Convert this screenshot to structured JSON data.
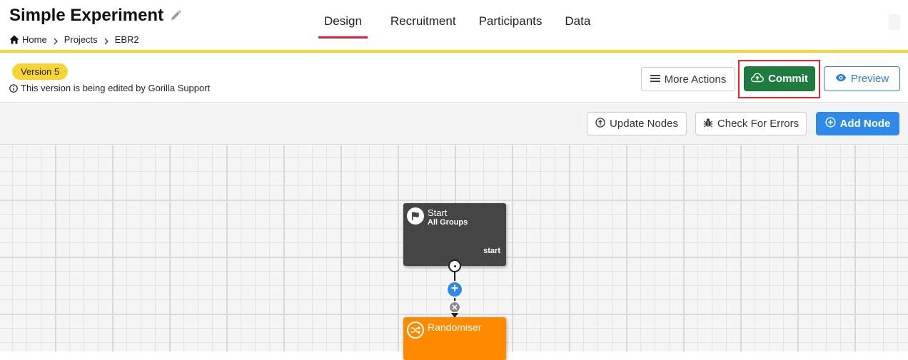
{
  "header": {
    "title": "Simple Experiment",
    "breadcrumb": [
      {
        "label": "Home",
        "icon": "home-icon"
      },
      {
        "label": "Projects"
      },
      {
        "label": "EBR2"
      }
    ],
    "tabs": [
      {
        "label": "Design",
        "active": true
      },
      {
        "label": "Recruitment"
      },
      {
        "label": "Participants"
      },
      {
        "label": "Data"
      }
    ]
  },
  "version": {
    "badge": "Version 5",
    "note": "This version is being edited by Gorilla Support"
  },
  "actions": {
    "more_actions": "More Actions",
    "commit": "Commit",
    "preview": "Preview"
  },
  "toolbar": {
    "update_nodes": "Update Nodes",
    "check_errors": "Check For Errors",
    "add_node": "Add Node"
  },
  "nodes": {
    "start": {
      "title": "Start",
      "subtitle": "All Groups",
      "port_label": "start",
      "icon": "flag-icon",
      "color": "#454545"
    },
    "randomiser": {
      "title": "Randomiser",
      "icon": "shuffle-icon",
      "color": "#ff8a00"
    }
  },
  "colors": {
    "accent_yellow": "#f5d93b",
    "active_tab": "#d9233a",
    "commit_green": "#1e7d3e",
    "primary_blue": "#2d8ae8",
    "highlight_red": "#e0262b"
  }
}
